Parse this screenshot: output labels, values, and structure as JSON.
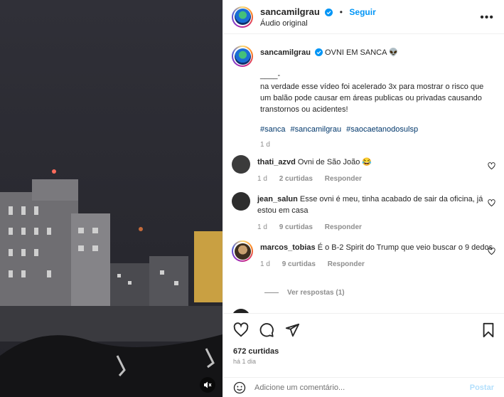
{
  "post": {
    "username": "sancamilgrau",
    "follow_label": "Seguir",
    "separator": "•",
    "audio": "Áudio original",
    "more_label": "•••"
  },
  "caption": {
    "username": "sancamilgrau",
    "title": "OVNI EM SANCA 👽",
    "dash": "____-",
    "text": "na verdade esse vídeo foi acelerado 3x para mostrar o risco que um balão pode causar em áreas publicas ou privadas causando transtornos ou acidentes!",
    "hashtags": [
      "#sanca",
      "#sancamilgrau",
      "#saocaetanodosulsp"
    ],
    "time": "1 d"
  },
  "comments": [
    {
      "user": "thati_azvd",
      "text": "Ovni de São João 😂",
      "time": "1 d",
      "likes": "2 curtidas",
      "reply": "Responder",
      "avatar_color": "#3b3b3b"
    },
    {
      "user": "jean_salun",
      "text": "Esse ovni é meu, tinha acabado de sair da oficina, já estou em casa",
      "time": "1 d",
      "likes": "9 curtidas",
      "reply": "Responder",
      "avatar_color": "#2e2e2e"
    },
    {
      "user": "marcos_tobias",
      "text": "É o B-2 Spirit do Trump que veio buscar o 9 dedos",
      "time": "1 d",
      "likes": "9 curtidas",
      "reply": "Responder",
      "avatar_color": "#8a6a40"
    }
  ],
  "view_replies": "Ver respostas (1)",
  "likes": "672 curtidas",
  "posted": "há 1 dia",
  "add_comment": {
    "placeholder": "Adicione um comentário...",
    "post_label": "Postar"
  },
  "colors": {
    "accent": "#0095f6",
    "verified": "#0095f6",
    "hashtag": "#00376b"
  },
  "icons": [
    "heart-icon",
    "comment-icon",
    "share-icon",
    "bookmark-icon",
    "emoji-icon",
    "mute-icon"
  ]
}
